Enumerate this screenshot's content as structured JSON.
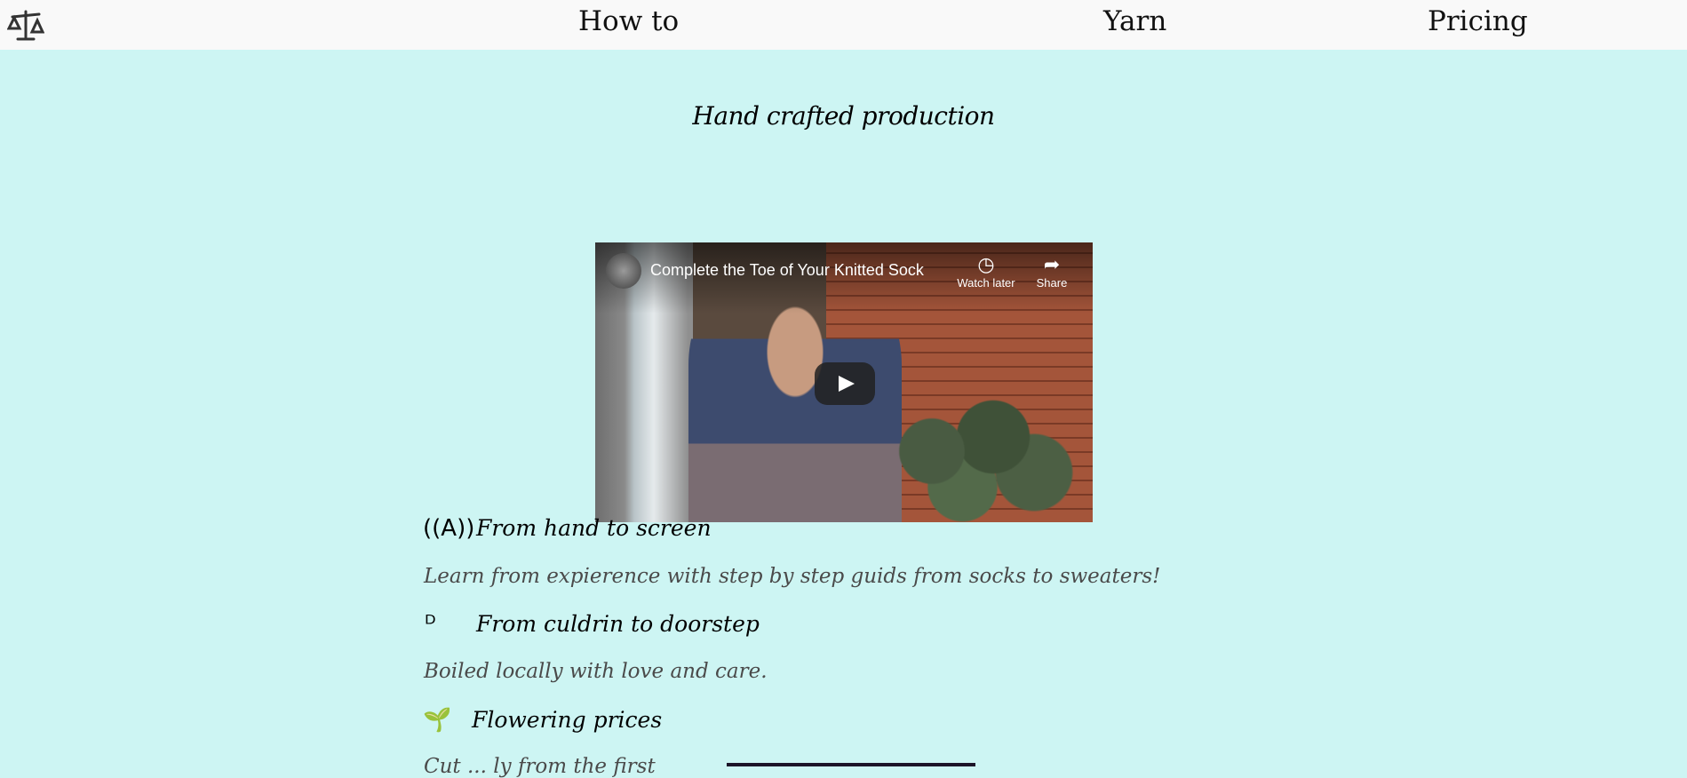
{
  "nav": {
    "logo_icon": "scale-balance-icon",
    "links": [
      "How to",
      "Yarn",
      "Pricing"
    ]
  },
  "headline": "Hand crafted production",
  "video": {
    "title": "Complete the Toe of Your Knitted Sock",
    "watch_later": "Watch later",
    "share": "Share"
  },
  "features": [
    {
      "icon": "broadcast-icon",
      "title": "From hand to screen",
      "desc": "Learn from expierence with step by step guids from socks to sweaters!"
    },
    {
      "icon": "test-tubes-icon",
      "title": "From culdrin to doorstep",
      "desc": "Boiled locally with love and care."
    },
    {
      "icon": "seedling-icon",
      "title": "Flowering prices",
      "desc": "Cut ... ly from the first"
    }
  ],
  "colors": {
    "background": "#cdf5f3",
    "nav_background": "#f9f9f9"
  }
}
